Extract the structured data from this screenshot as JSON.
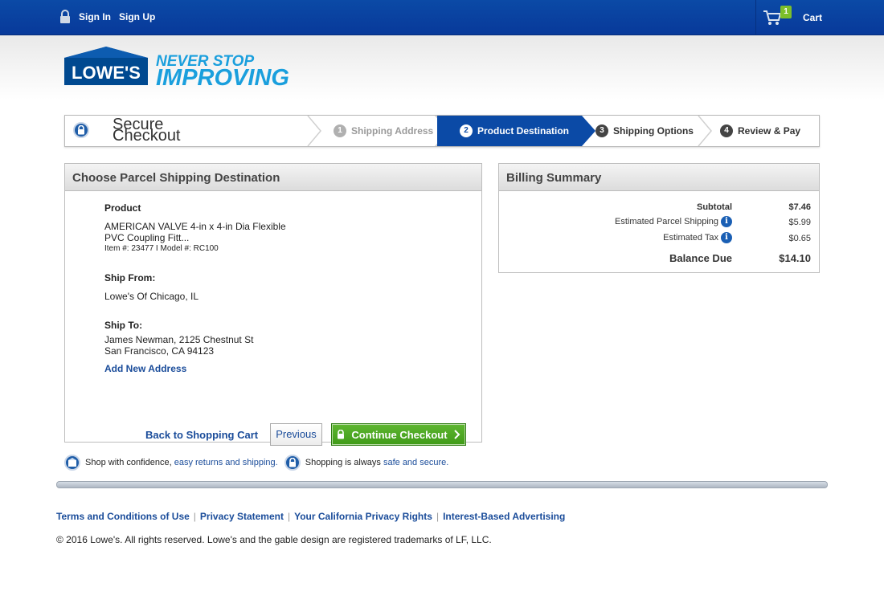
{
  "topbar": {
    "sign_in": "Sign In",
    "sign_up": "Sign Up",
    "cart_count": "1",
    "cart_label": "Cart"
  },
  "brand": {
    "logo_text": "LOWE'S",
    "tagline_line1": "NEVER STOP",
    "tagline_line2": "IMPROVING",
    "logo_color": "#004990",
    "tagline_color": "#1a9fdd"
  },
  "steps": {
    "title": "Secure Checkout",
    "items": [
      {
        "num": "1",
        "label": "Shipping Address"
      },
      {
        "num": "2",
        "label": "Product Destination"
      },
      {
        "num": "3",
        "label": "Shipping Options"
      },
      {
        "num": "4",
        "label": "Review & Pay"
      }
    ]
  },
  "destination": {
    "heading": "Choose Parcel Shipping Destination",
    "product_label": "Product",
    "product_name_line1": "AMERICAN VALVE 4-in x 4-in Dia Flexible",
    "product_name_line2": "PVC Coupling Fitt...",
    "product_ids": "Item #: 23477 I Model #: RC100",
    "ship_from_label": "Ship From:",
    "ship_from_value": "Lowe's Of Chicago, IL",
    "ship_to_label": "Ship To:",
    "ship_to_line1": "James Newman, 2125 Chestnut St",
    "ship_to_line2": "San Francisco, CA 94123",
    "add_address": "Add New Address",
    "back_link": "Back to Shopping Cart",
    "previous": "Previous",
    "continue": "Continue Checkout"
  },
  "billing": {
    "heading": "Billing Summary",
    "subtotal_label": "Subtotal",
    "subtotal_value": "$7.46",
    "shipping_label": "Estimated Parcel Shipping",
    "shipping_value": "$5.99",
    "tax_label": "Estimated Tax",
    "tax_value": "$0.65",
    "balance_label": "Balance Due",
    "balance_value": "$14.10"
  },
  "confidence": {
    "text1": "Shop with confidence,",
    "link1": "easy returns and shipping.",
    "text2": "Shopping is always",
    "link2": "safe and secure."
  },
  "footer": {
    "links": [
      "Terms and Conditions of Use",
      "Privacy Statement",
      "Your California Privacy Rights",
      "Interest-Based Advertising"
    ],
    "copyright": "© 2016 Lowe's. All rights reserved. Lowe's and the gable design are registered trademarks of LF, LLC."
  }
}
